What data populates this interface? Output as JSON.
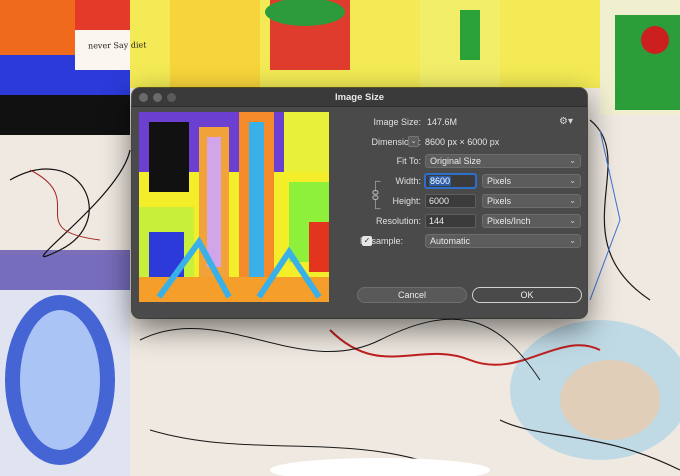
{
  "canvas": {
    "caption": "never Say diet"
  },
  "dialog": {
    "title": "Image Size",
    "image_size": {
      "label": "Image Size:",
      "value": "147.6M"
    },
    "dimensions": {
      "label": "Dimensions:",
      "value": "8600 px  ×  6000 px"
    },
    "fit_to": {
      "label": "Fit To:",
      "value": "Original Size"
    },
    "width": {
      "label": "Width:",
      "value": "8600",
      "unit": "Pixels"
    },
    "height": {
      "label": "Height:",
      "value": "6000",
      "unit": "Pixels"
    },
    "resolution": {
      "label": "Resolution:",
      "value": "144",
      "unit": "Pixels/Inch"
    },
    "resample": {
      "label": "Resample:",
      "value": "Automatic",
      "checked": true
    },
    "cancel_label": "Cancel",
    "ok_label": "OK"
  },
  "colors": {
    "dialog_bg": "#4a4a4a",
    "titlebar_bg": "#3a3a3a",
    "focus_ring": "#2f6fcc"
  },
  "icons": [
    "gear-icon",
    "chevron-down-icon",
    "link-icon",
    "checkmark-icon"
  ]
}
